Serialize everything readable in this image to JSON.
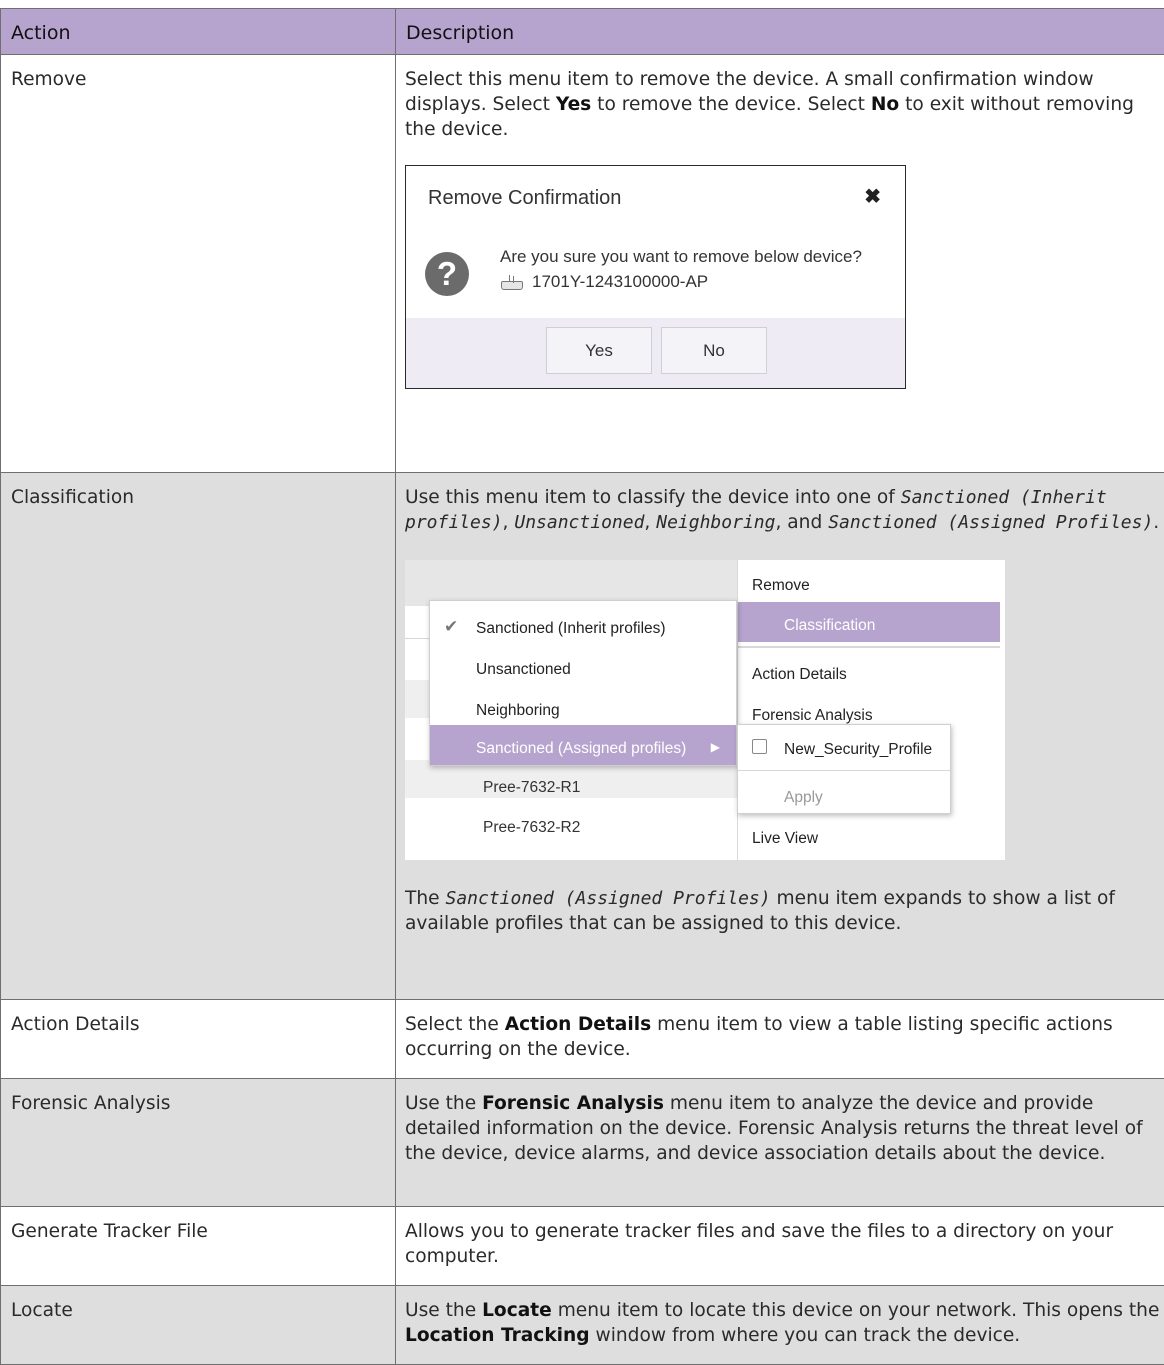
{
  "table": {
    "headers": {
      "action": "Action",
      "description": "Description"
    },
    "rows": {
      "remove": {
        "action": "Remove",
        "desc_parts": [
          "Select this menu item to remove the device. A small confirmation window displays. Select ",
          "Yes",
          " to remove the device. Select ",
          "No",
          " to exit without removing the device."
        ]
      },
      "classification": {
        "action": "Classification",
        "desc_parts": [
          "Use this menu item to classify the device into one of ",
          "Sanctioned (Inherit profiles)",
          ", ",
          "Unsanctioned",
          ", ",
          "Neighboring",
          ", and ",
          "Sanctioned (Assigned Profiles)",
          "."
        ],
        "after_parts": [
          "The ",
          "Sanctioned (Assigned Profiles)",
          " menu item expands to show a list of available profiles that can be assigned to this device."
        ]
      },
      "action_details": {
        "action": "Action Details",
        "desc_parts": [
          "Select the ",
          "Action Details",
          " menu item to view a table listing specific actions occurring on the device."
        ]
      },
      "forensic": {
        "action": "Forensic Analysis",
        "desc_parts": [
          "Use the ",
          "Forensic Analysis",
          " menu item to analyze the device and provide detailed information on the device. Forensic Analysis returns the threat level of the device, device alarms, and device association details about the device."
        ]
      },
      "tracker": {
        "action": "Generate Tracker File",
        "desc": "Allows you to generate tracker files and save the files to a directory on your computer."
      },
      "locate": {
        "action": "Locate",
        "desc_parts": [
          "Use the ",
          "Locate",
          " menu item to locate this device on your network. This opens the ",
          "Location Tracking",
          " window from where you can track the device."
        ]
      }
    }
  },
  "remove_dialog": {
    "title": "Remove Confirmation",
    "close_glyph": "✖",
    "question_glyph": "?",
    "message": "Are you sure you want to remove below device?",
    "device": "1701Y-1243100000-AP",
    "yes": "Yes",
    "no": "No"
  },
  "classification_menu": {
    "main_items": {
      "remove": "Remove",
      "classification": "Classification",
      "action_details": "Action Details",
      "forensic": "Forensic Analysis",
      "live_view": "Live View"
    },
    "submenu": {
      "inherit": "Sanctioned (Inherit profiles)",
      "unsanctioned": "Unsanctioned",
      "neighboring": "Neighboring",
      "assigned": "Sanctioned (Assigned profiles)",
      "check_glyph": "✔",
      "arrow_glyph": "▶"
    },
    "profiles": {
      "profile": "New_Security_Profile",
      "apply": "Apply"
    },
    "background_rows": [
      "Pree-7632-R1",
      "Pree-7632-R2"
    ]
  },
  "colors": {
    "header_bg": "#b6a4cf",
    "highlight": "#b6a4cf",
    "alt_row_bg": "#dedede"
  }
}
